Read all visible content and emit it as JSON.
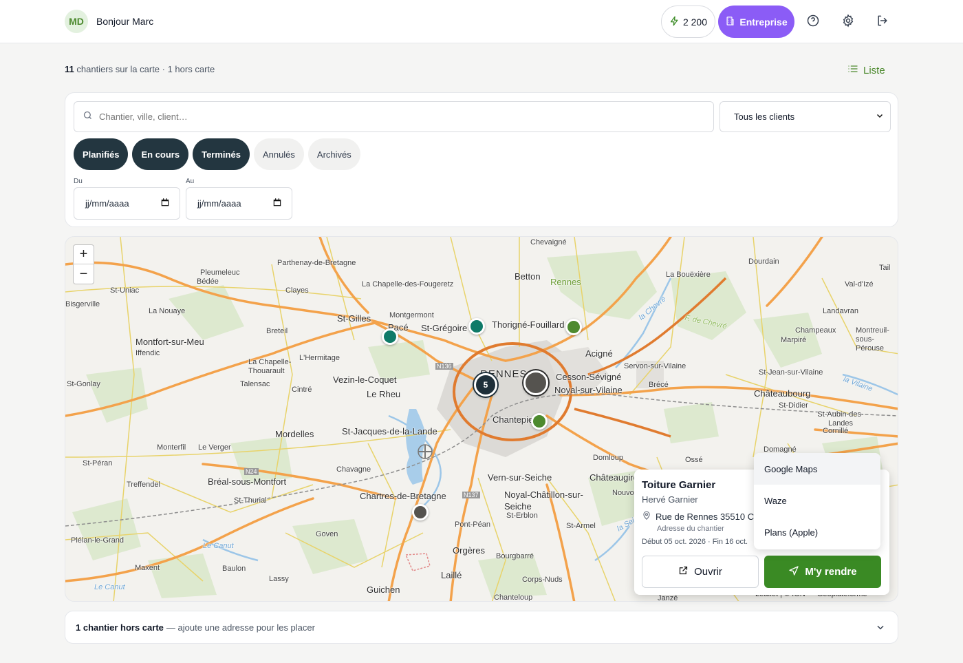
{
  "header": {
    "avatar_initials": "MD",
    "greeting": "Bonjour Marc",
    "credits": "2 200",
    "plan_label": "Entreprise",
    "icons": [
      "lightning-icon",
      "building-icon",
      "help-icon",
      "gear-icon",
      "logout-icon"
    ]
  },
  "summary": {
    "count": "11",
    "text": "chantiers sur la carte · 1 hors carte",
    "list_toggle": "Liste"
  },
  "filters": {
    "search_placeholder": "Chantier, ville, client…",
    "client_select": "Tous les clients",
    "status_chips": [
      {
        "label": "Planifiés",
        "active": true
      },
      {
        "label": "En cours",
        "active": true
      },
      {
        "label": "Terminés",
        "active": true
      },
      {
        "label": "Annulés",
        "active": false
      },
      {
        "label": "Archivés",
        "active": false
      }
    ],
    "date_from_label": "Du",
    "date_to_label": "Au",
    "date_placeholder": "jj/mm/aaaa"
  },
  "map": {
    "zoom_in": "+",
    "zoom_out": "−",
    "cluster_count": "5",
    "places": [
      "Chevaigné",
      "Rennes",
      "Betton",
      "La Bouëxière",
      "Dourdain",
      "Parthenay-de-Bretagne",
      "Pleumeleuc",
      "Bédée",
      "La Chapelle-des-Fougeretz",
      "Clayes",
      "St-Uniac",
      "La Nouaye",
      "Montgermont",
      "Pacé",
      "St-Grégoire",
      "Thorigné-Fouillard",
      "St-Gilles",
      "Breteil",
      "Montfort-sur-Meu",
      "Iffendic",
      "L'Hermitage",
      "La Chapelle-Thouarault",
      "Talensac",
      "Cintré",
      "Vezin-le-Coquet",
      "Le Rheu",
      "RENNES",
      "Cesson-Sévigné",
      "Noyal-sur-Vilaine",
      "Acigné",
      "Servon-sur-Vilaine",
      "Brécé",
      "Châteaubourg",
      "St-Didier",
      "Chantepie",
      "Mordelles",
      "St-Jacques-de-la-Lande",
      "Domloup",
      "Vern-sur-Seiche",
      "Noyal-Châtillon-sur-Seiche",
      "St-Erblon",
      "Chavagne",
      "Bréal-sous-Montfort",
      "St-Thurial",
      "Chartres-de-Bretagne",
      "Pont-Péan",
      "St-Armel",
      "Orgères",
      "Bourgbarré",
      "Laillé",
      "Goven",
      "Plélan-le-Grand",
      "Maxent",
      "Baulon",
      "Lassy",
      "Guichen",
      "Corps-Nuds",
      "Chanteloup",
      "Treffendel",
      "Monterfil",
      "Le Verger",
      "St-Péran",
      "St-Gonlay",
      "Champeaux",
      "Marpiré",
      "Landavran",
      "Val-d'Izé",
      "Montreuil-sous-Pérouse",
      "St-Jean-sur-Vilaine",
      "St-Aubin-des-Landes",
      "Cornillé",
      "Domagné",
      "Ossé",
      "Châteaugiron",
      "Nouvoitou",
      "Janzé",
      "Tail",
      "Bisgerville",
      "Saint-Gilles",
      "Le Canut",
      "F. de Chevré",
      "la Vilaine",
      "la Seiche",
      "la Chevré",
      "N136",
      "N137",
      "N24"
    ],
    "attribution": "Leaflet | © IGN — Géoplateforme"
  },
  "popup": {
    "title": "Toiture Garnier",
    "client": "Hervé Garnier",
    "address": "Rue de Rennes 35510 C",
    "address_note": "Adresse du chantier",
    "dates": "Début 05 oct. 2026 · Fin 16 oct.",
    "open_label": "Ouvrir",
    "go_label": "M'y rendre",
    "nav_options": [
      "Google Maps",
      "Waze",
      "Plans (Apple)"
    ]
  },
  "hors_carte": {
    "bold": "1 chantier hors carte",
    "text": "— ajoute une adresse pour les placer"
  },
  "colors": {
    "accent_green": "#3a8a24",
    "plan_purple": "#8b5cf6",
    "chip_dark": "#233640",
    "marker_teal": "#0f7a68",
    "marker_green": "#4d8a2f",
    "marker_gray": "#55534f"
  }
}
